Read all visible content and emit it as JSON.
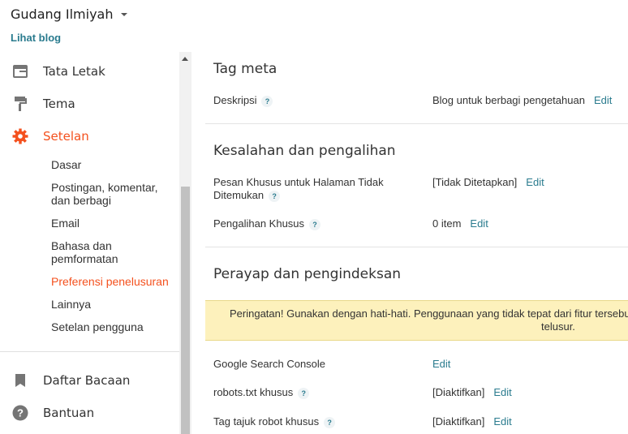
{
  "header": {
    "blog_name": "Gudang Ilmiyah",
    "view_blog": "Lihat blog"
  },
  "sidebar": {
    "items": [
      {
        "label": "Tata Letak",
        "icon": "layout-icon"
      },
      {
        "label": "Tema",
        "icon": "paint-roller-icon"
      },
      {
        "label": "Setelan",
        "icon": "gear-icon",
        "active": true
      },
      {
        "label": "Daftar Bacaan",
        "icon": "bookmark-icon"
      },
      {
        "label": "Bantuan",
        "icon": "help-circle-icon"
      }
    ],
    "settings_sub": [
      "Dasar",
      "Postingan, komentar,",
      "dan berbagi",
      "Email",
      "Bahasa dan",
      "pemformatan",
      "Preferensi penelusuran",
      "Lainnya",
      "Setelan pengguna"
    ]
  },
  "main": {
    "sections": {
      "meta": {
        "title": "Tag meta",
        "description_label": "Deskripsi",
        "description_value": "Blog untuk berbagi pengetahuan"
      },
      "errors": {
        "title": "Kesalahan dan pengalihan",
        "notfound_label_1": "Pesan Khusus untuk Halaman Tidak",
        "notfound_label_2": "Ditemukan",
        "notfound_value": "[Tidak Ditetapkan]",
        "redirect_label": "Pengalihan Khusus",
        "redirect_value": "0 item"
      },
      "crawl": {
        "title": "Perayap dan pengindeksan",
        "warning_1": "Peringatan! Gunakan dengan hati-hati. Penggunaan yang tidak tepat dari fitur tersebut",
        "warning_2": "telusur.",
        "gsc_label": "Google Search Console",
        "robots_label": "robots.txt khusus",
        "robots_value": "[Diaktifkan]",
        "header_tags_label": "Tag tajuk robot khusus",
        "header_tags_value": "[Diaktifkan]"
      }
    },
    "edit_label": "Edit",
    "help_glyph": "?"
  },
  "colors": {
    "accent": "#f4511e",
    "link": "#2a7b8e",
    "warning_bg": "#fdf1bc"
  }
}
